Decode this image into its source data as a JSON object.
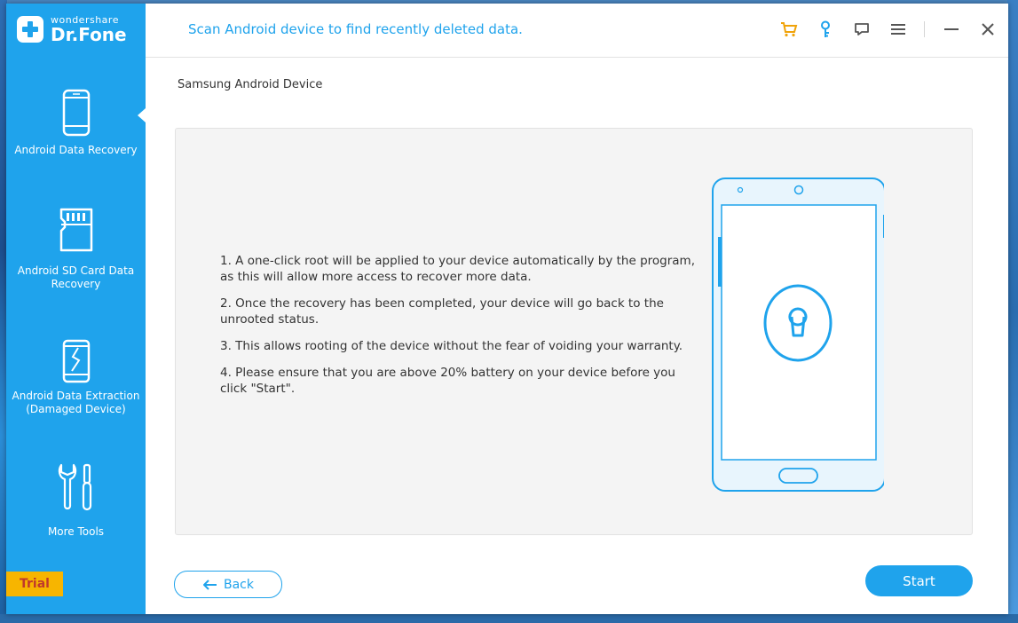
{
  "app": {
    "logo_small": "wondershare",
    "logo_big": "Dr.Fone",
    "title": "Scan Android device to find recently deleted data."
  },
  "titlebar_icons": [
    "cart-icon",
    "key-icon",
    "feedback-icon",
    "menu-icon",
    "minimize-icon",
    "close-icon"
  ],
  "sidebar": {
    "items": [
      {
        "label": "Android Data Recovery",
        "icon": "phone-icon",
        "active": true
      },
      {
        "label": "Android SD Card Data Recovery",
        "icon": "sd-card-icon",
        "active": false
      },
      {
        "label": "Android Data Extraction (Damaged Device)",
        "icon": "broken-phone-icon",
        "active": false
      },
      {
        "label": "More Tools",
        "icon": "tools-icon",
        "active": false
      }
    ],
    "trial_label": "Trial"
  },
  "main": {
    "breadcrumb": "Samsung Android Device",
    "instructions": [
      "1. A one-click root will be applied to your device automatically by the program, as this will allow more access to recover more data.",
      "2. Once the recovery has been completed, your device will go back to the unrooted status.",
      "3. This allows rooting of the device without the fear of voiding your warranty.",
      "4. Please ensure that you are above 20% battery on your device before you click \"Start\"."
    ],
    "back_label": "Back",
    "start_label": "Start"
  },
  "colors": {
    "accent": "#1fa3ec",
    "trial_bg": "#f7b500",
    "trial_text": "#c0392b",
    "cart": "#f0a30a"
  }
}
